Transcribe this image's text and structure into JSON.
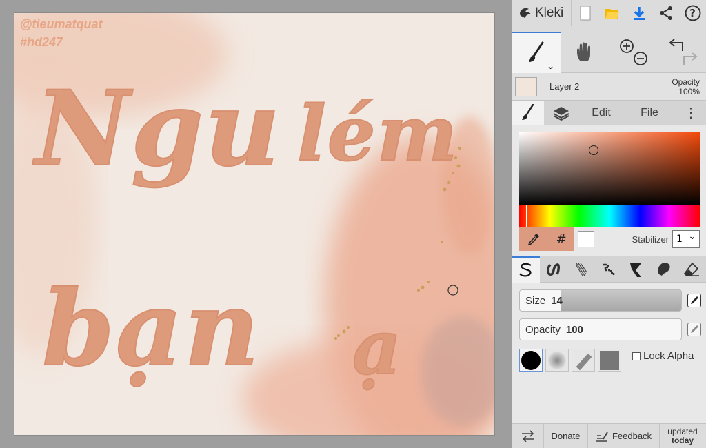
{
  "canvas": {
    "watermark_line1": "@tieumatquat",
    "watermark_line2": "#hd247",
    "text_line1a": "Ngu",
    "text_line1b": "lém",
    "text_line2a": "bạn",
    "text_line2b": "ạ",
    "background_color": "#f2e9e2",
    "lettering_color": "#dd9b7c"
  },
  "topbar": {
    "app_name": "Kleki",
    "icons": [
      "new-file-icon",
      "open-folder-icon",
      "download-icon",
      "share-icon",
      "help-icon"
    ],
    "help_glyph": "?"
  },
  "toolbar": {
    "tools": [
      "brush-icon",
      "hand-icon",
      "zoom-in-icon",
      "zoom-out-icon",
      "undo-icon",
      "redo-icon"
    ]
  },
  "layer": {
    "name": "Layer 2",
    "opacity_label": "Opacity",
    "opacity_value": "100%"
  },
  "tabs": {
    "edit": "Edit",
    "file": "File",
    "more": "⋮"
  },
  "color": {
    "current": "#dc9a80",
    "secondary": "#ffffff",
    "hex_glyph": "#",
    "stabilizer_label": "Stabilizer",
    "stabilizer_value": "1"
  },
  "brush": {
    "size_label": "Size",
    "size_value": "14",
    "size_fraction": 0.25,
    "opacity_label": "Opacity",
    "opacity_value": "100",
    "opacity_fraction": 0.0,
    "lock_alpha_label": "Lock Alpha"
  },
  "footer": {
    "donate": "Donate",
    "feedback": "Feedback",
    "updated_line1": "updated",
    "updated_line2": "today"
  },
  "colors": {
    "accent": "#3c7bd6",
    "download_blue": "#1a73e8",
    "folder_yellow": "#f2b900"
  }
}
